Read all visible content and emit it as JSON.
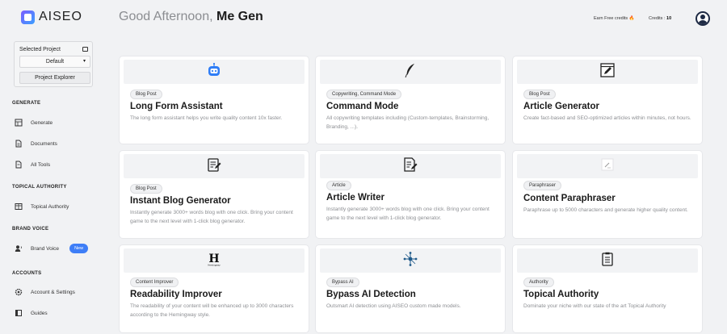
{
  "app": {
    "name": "AISEO"
  },
  "sidebar": {
    "selected_project_label": "Selected Project",
    "project_value": "Default",
    "project_explorer_label": "Project Explorer",
    "sections": {
      "generate": "GENERATE",
      "topical": "TOPICAL AUTHORITY",
      "brand": "BRAND VOICE",
      "accounts": "ACCOUNTS"
    },
    "items": {
      "generate": "Generate",
      "documents": "Documents",
      "all_tools": "All Tools",
      "topical_authority": "Topical Authority",
      "brand_voice": "Brand Voice",
      "brand_voice_badge": "New",
      "account_settings": "Account & Settings",
      "guides": "Guides"
    }
  },
  "header": {
    "greeting": "Good Afternoon,",
    "user": "Me Gen",
    "earn_credits": "Earn Free credits 🔥",
    "credits_label": "Credits :",
    "credits_value": "10"
  },
  "cards": [
    {
      "icon": "robot-icon",
      "tag": "Blog Post",
      "title": "Long Form Assistant",
      "desc": "The long form assistant helps you write quality content 10x faster."
    },
    {
      "icon": "feather-icon",
      "tag": "Copywriting, Command Mode",
      "title": "Command Mode",
      "desc": "All copywriting templates including (Custom-templates, Brainstorming, Branding, ...)."
    },
    {
      "icon": "edit-window-icon",
      "tag": "Blog Post",
      "title": "Article Generator",
      "desc": "Create fact-based and SEO-optimized articles within minutes, not hours."
    },
    {
      "icon": "notepad-pen-icon",
      "tag": "Blog Post",
      "title": "Instant Blog Generator",
      "desc": "Instantly generate 3000+ words blog with one click. Bring your content game to the next level with 1-click blog generator."
    },
    {
      "icon": "document-pen-icon",
      "tag": "Article",
      "title": "Article Writer",
      "desc": "Instantly generate 3000+ words blog with one click. Bring your content game to the next level with 1-click blog generator."
    },
    {
      "icon": "paraphrase-icon",
      "tag": "Paraphraser",
      "title": "Content Paraphraser",
      "desc": "Paraphrase up to 5000 characters and generate higher quality content."
    },
    {
      "icon": "hemingway-icon",
      "tag": "Content Improver",
      "title": "Readability Improver",
      "desc": "The readability of your content will be enhanced up to 3000 characters according to the Hemingway style."
    },
    {
      "icon": "network-icon",
      "tag": "Bypass AI",
      "title": "Bypass AI Detection",
      "desc": "Outsmart AI detection using AISEO custom made models."
    },
    {
      "icon": "checklist-icon",
      "tag": "Authority",
      "title": "Topical Authority",
      "desc": "Dominate your niche with our state of the art Topical Authority"
    }
  ],
  "hemingway_logo_letter": "H",
  "hemingway_logo_word": "Hemingway"
}
